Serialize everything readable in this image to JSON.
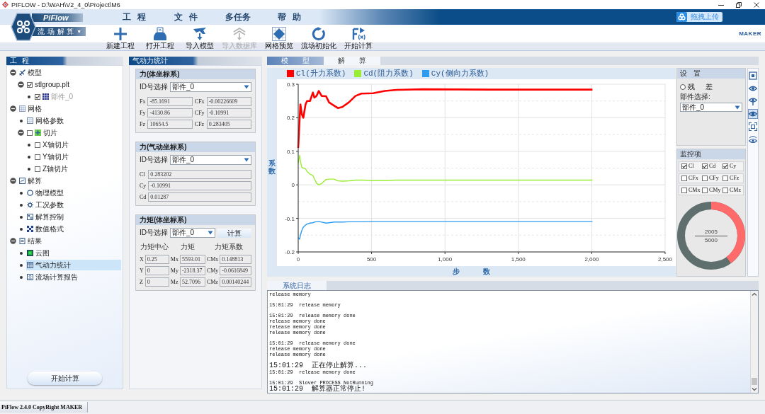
{
  "title_bar": {
    "title": "PIFLOW - D:\\WAH\\V2_4_0\\Project\\M6"
  },
  "logo": {
    "name": "PiFlow",
    "module": "流 场 解 算",
    "caret": "▼"
  },
  "menu": [
    {
      "label": "工 程"
    },
    {
      "label": "文 件"
    },
    {
      "label": "多任务"
    },
    {
      "label": "帮 助"
    }
  ],
  "upload_button": {
    "label": "拖拽上传"
  },
  "toolbar": [
    {
      "label": "新建工程",
      "disabled": false
    },
    {
      "label": "打开工程",
      "disabled": false
    },
    {
      "label": "导入模型",
      "disabled": false
    },
    {
      "label": "导入数据库",
      "disabled": true
    },
    {
      "label": "网格预览",
      "disabled": false
    },
    {
      "label": "流场初始化",
      "disabled": false
    },
    {
      "label": "开始计算",
      "disabled": false
    }
  ],
  "brand": "MAKER",
  "project_panel": {
    "title": "工 程",
    "tree": [
      {
        "label": "模型",
        "expanded": true,
        "selected": false,
        "disabled": false,
        "children": [
          {
            "label": "stlgroup.plt",
            "expanded": true,
            "checked": true,
            "selected": false,
            "disabled": false,
            "children": [
              {
                "label": "部件_0",
                "checked": true,
                "selected": false,
                "disabled": true
              }
            ]
          }
        ]
      },
      {
        "label": "网格",
        "expanded": true,
        "selected": false,
        "disabled": false,
        "children": [
          {
            "label": "网格参数",
            "selected": false,
            "disabled": false
          },
          {
            "label": "切片",
            "expanded": true,
            "checked": false,
            "selected": false,
            "disabled": false,
            "children": [
              {
                "label": "X轴切片",
                "checked": false,
                "selected": false,
                "disabled": false
              },
              {
                "label": "Y轴切片",
                "checked": false,
                "selected": false,
                "disabled": false
              },
              {
                "label": "Z轴切片",
                "checked": false,
                "selected": false,
                "disabled": false
              }
            ]
          }
        ]
      },
      {
        "label": "解算",
        "expanded": true,
        "selected": false,
        "disabled": false,
        "children": [
          {
            "label": "物理模型",
            "selected": false,
            "disabled": false
          },
          {
            "label": "工况参数",
            "selected": false,
            "disabled": false
          },
          {
            "label": "解算控制",
            "selected": false,
            "disabled": false
          },
          {
            "label": "数值格式",
            "selected": false,
            "disabled": false
          }
        ]
      },
      {
        "label": "结果",
        "expanded": true,
        "selected": false,
        "disabled": false,
        "children": [
          {
            "label": "云图",
            "selected": false,
            "disabled": false
          },
          {
            "label": "气动力统计",
            "selected": true,
            "disabled": false
          },
          {
            "label": "流场计算报告",
            "selected": false,
            "disabled": false
          }
        ]
      }
    ],
    "start_button": "开始计算"
  },
  "aero_panel": {
    "title": "气动力统计",
    "sections": [
      {
        "kind": "pairs",
        "title": "力(体坐标系)",
        "id_label": "ID号选择",
        "id_value": "部件_0",
        "fields": [
          {
            "label": "Fx",
            "value": "-85.1691"
          },
          {
            "label": "CFx",
            "value": "-0.00226609"
          },
          {
            "label": "Fy",
            "value": "-4130.86"
          },
          {
            "label": "CFy",
            "value": "-0.10991"
          },
          {
            "label": "Fz",
            "value": "10654.5"
          },
          {
            "label": "CFz",
            "value": "0.283405"
          }
        ]
      },
      {
        "kind": "list",
        "title": "力(气动坐标系)",
        "id_label": "ID号选择",
        "id_value": "部件_0",
        "fields": [
          {
            "label": "Cl",
            "value": "0.283202"
          },
          {
            "label": "Cy",
            "value": "-0.10991"
          },
          {
            "label": "Cd",
            "value": "0.01287"
          }
        ]
      },
      {
        "kind": "table",
        "title": "力矩(体坐标系)",
        "id_label": "ID号选择",
        "id_value": "部件_0",
        "button": "计算",
        "columns": [
          "力矩中心",
          "力矩",
          "力矩系数"
        ],
        "fields": [
          {
            "label": "X",
            "value": "0.25"
          },
          {
            "label": "Mx",
            "value": "5593.01"
          },
          {
            "label": "CMx",
            "value": "0.148813"
          },
          {
            "label": "Y",
            "value": "0"
          },
          {
            "label": "My",
            "value": "-2318.37"
          },
          {
            "label": "CMy",
            "value": "-0.0616849"
          },
          {
            "label": "Z",
            "value": "0"
          },
          {
            "label": "Mz",
            "value": "52.7096"
          },
          {
            "label": "CMz",
            "value": "0.00140244"
          }
        ]
      }
    ]
  },
  "solver_view": {
    "tabs": [
      {
        "label": "模 型",
        "selected": false
      },
      {
        "label": "解 算",
        "selected": true
      }
    ],
    "chart": {
      "chart_data": {
        "type": "line",
        "xlabel": "步 数",
        "ylabel": "系数",
        "x": [
          0,
          10,
          15,
          25,
          35,
          50,
          60,
          80,
          100,
          110,
          125,
          140,
          160,
          190,
          210,
          245,
          270,
          300,
          345,
          390,
          430,
          510,
          590,
          670,
          850,
          1300,
          2005
        ],
        "series": [
          {
            "name": "Cl(升力系数)",
            "color": "#ff0000",
            "values": [
              0.11,
              0.2,
              0.24,
              0.21,
              0.2,
              0.24,
              0.25,
              0.25,
              0.275,
              0.26,
              0.265,
              0.28,
              0.265,
              0.264,
              0.246,
              0.236,
              0.229,
              0.232,
              0.246,
              0.265,
              0.272,
              0.273,
              0.28,
              0.283,
              0.285,
              0.284,
              0.284
            ]
          },
          {
            "name": "Cd(阻力系数)",
            "color": "#99ee33",
            "values": [
              0.065,
              0.088,
              0.07,
              0.052,
              0.05,
              0.048,
              0.04,
              0.032,
              0.028,
              0.018,
              0.005,
              0.0,
              0.004,
              0.016,
              0.017,
              0.017,
              0.012,
              0.011,
              0.012,
              0.014,
              0.014,
              0.013,
              0.013,
              0.014,
              0.014,
              0.014,
              0.014
            ]
          },
          {
            "name": "Cy(侧向力系数)",
            "color": "#2b9cf2",
            "values": [
              -0.157,
              -0.162,
              -0.15,
              -0.135,
              -0.126,
              -0.12,
              -0.117,
              -0.114,
              -0.113,
              -0.111,
              -0.11,
              -0.109,
              -0.111,
              -0.114,
              -0.113,
              -0.111,
              -0.111,
              -0.111,
              -0.11,
              -0.11,
              -0.11,
              -0.109,
              -0.109,
              -0.109,
              -0.109,
              -0.109,
              -0.109
            ]
          }
        ],
        "xlim": [
          0,
          2500
        ],
        "ylim": [
          -0.2,
          0.3
        ],
        "xticks": [
          {
            "value": 0,
            "label": "0"
          },
          500,
          {
            "value": 1000,
            "label": "1,000"
          },
          {
            "value": 1500,
            "label": "1,500"
          },
          {
            "value": 2000,
            "label": "2,000"
          },
          {
            "value": 2500,
            "label": "2,500"
          }
        ],
        "yticks": [
          -0.2,
          -0.1,
          {
            "value": 0,
            "label": "0"
          },
          0.1,
          0.2,
          0.3
        ],
        "grid": true,
        "legend": "top"
      }
    },
    "settings": {
      "title": "设 置",
      "radio": {
        "label": "残 差",
        "selected": false
      },
      "part_label": "部件选择:",
      "part_value": "部件_0"
    },
    "monitor": {
      "title": "监控项",
      "options": [
        {
          "label": "Cl",
          "checked": true
        },
        {
          "label": "Cd",
          "checked": true
        },
        {
          "label": "Cy",
          "checked": true
        },
        {
          "label": "CFx",
          "checked": false
        },
        {
          "label": "CFy",
          "checked": false
        },
        {
          "label": "CFz",
          "checked": false
        },
        {
          "label": "CMx",
          "checked": false
        },
        {
          "label": "CMy",
          "checked": false
        },
        {
          "label": "CMz",
          "checked": false
        }
      ],
      "progress": {
        "current": "2005",
        "total": "5000",
        "level": 0.401
      }
    },
    "view_tools": [
      {
        "selected": false
      },
      {
        "selected": false
      },
      {
        "selected": false
      },
      {
        "selected": true
      },
      {
        "selected": false
      },
      {
        "selected": false
      }
    ],
    "log": {
      "title": "系统日志",
      "groups": [
        [
          "release memory"
        ],
        [
          "15:01:29  release memory"
        ],
        [
          "15:01:29  release memory done",
          "release memory done",
          "release memory done",
          "release memory done"
        ],
        [
          "15:01:29  release memory done",
          "release memory done",
          "release memory done"
        ],
        [
          "15:01:29  正在停止解算...",
          "15:01:29  release memory done"
        ],
        [
          "15:01:29  Slover PROCESS NotRunning",
          "15:01:29  解算器正常停止!"
        ]
      ]
    }
  },
  "status_bar": {
    "text": "PiFlow 2.4.0 CopyRight MAKER"
  }
}
